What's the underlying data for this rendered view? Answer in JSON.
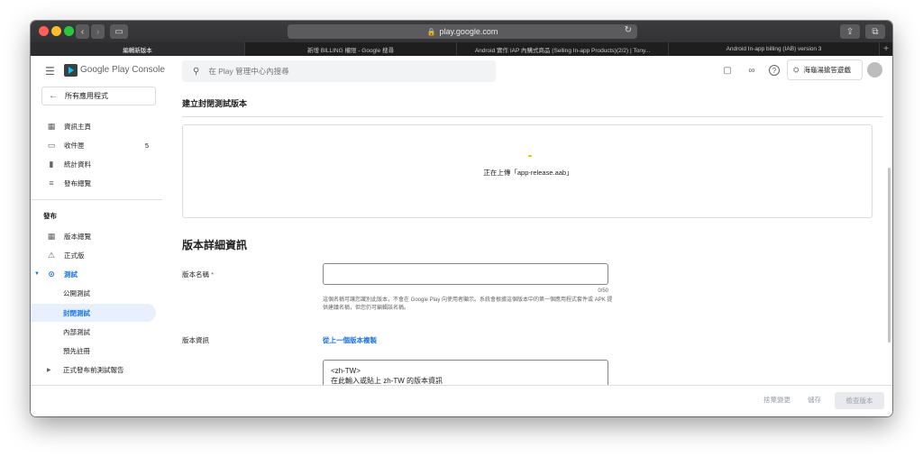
{
  "browser": {
    "url": "play.google.com",
    "tabs": [
      {
        "label": "編輯新版本",
        "active": true
      },
      {
        "label": "新增 BILLING 權限 - Google 搜尋",
        "active": false
      },
      {
        "label": "Android 實作 IAP 內購式商品 (Selling In-app Products)(2/2) | Tony...",
        "active": false
      },
      {
        "label": "Android In-app billing (IAB) version 3",
        "active": false
      }
    ],
    "new_tab": "+"
  },
  "header": {
    "brand": "Google Play Console",
    "search_placeholder": "在 Play 管理中心內搜尋",
    "developer_name": "海龜湯搶答遊戲"
  },
  "sidebar": {
    "all_apps": "所有應用程式",
    "top_items": [
      {
        "label": "資訊主頁",
        "icon": "dashboard-icon",
        "count": ""
      },
      {
        "label": "收件匣",
        "icon": "inbox-icon",
        "count": "5"
      },
      {
        "label": "統計資料",
        "icon": "bar-chart-icon",
        "count": ""
      },
      {
        "label": "發布總覽",
        "icon": "publishing-overview-icon",
        "count": ""
      }
    ],
    "section_title": "發布",
    "release_items": [
      {
        "label": "版本總覽"
      },
      {
        "label": "正式版"
      },
      {
        "label": "測試"
      },
      {
        "label": "公開測試"
      },
      {
        "label": "封閉測試"
      },
      {
        "label": "內部測試"
      },
      {
        "label": "預先註冊"
      },
      {
        "label": "正式發布前測試報告"
      }
    ]
  },
  "main": {
    "page_title": "建立封閉測試版本",
    "upload_status": "正在上傳「app-release.aab」",
    "details_title": "版本詳細資訊",
    "release_name_label": "版本名稱",
    "required_mark": "*",
    "release_name_value": "",
    "counter": "0/50",
    "help_text": "這個名稱可讓您識別此版本，不會在 Google Play 向使用者顯示。系統會根據這個版本中的第一個應用程式套件或 APK 提供建議名稱，但您仍可編輯該名稱。",
    "notes_label": "版本資訊",
    "copy_link": "從上一個版本複製",
    "notes_line1": "<zh-TW>",
    "notes_line2": "在此輸入或貼上 zh-TW 的版本資訊"
  },
  "footer": {
    "discard": "捨棄變更",
    "save": "儲存",
    "review": "檢查版本"
  },
  "colors": {
    "accent": "#1a73e8",
    "selected_bg": "#e8f0fe",
    "spinner": "#f4b400"
  }
}
